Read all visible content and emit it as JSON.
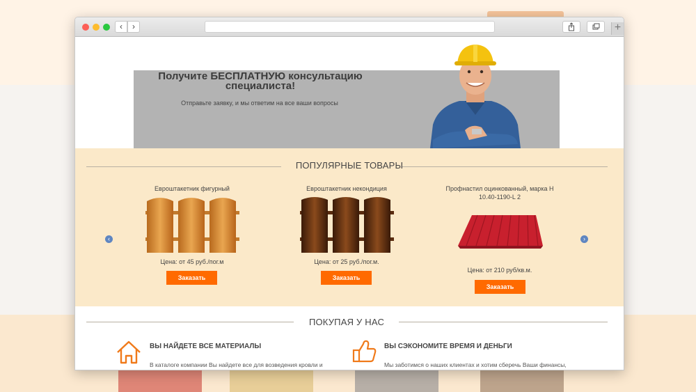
{
  "hero": {
    "title": "Получите БЕСПЛАТНУЮ консультацию специалиста!",
    "subtitle": "Отправьте заявку, и мы ответим на все ваши вопросы"
  },
  "popular": {
    "heading": "ПОПУЛЯРНЫЕ ТОВАРЫ",
    "products": [
      {
        "name": "Евроштакетник фигурный",
        "price": "Цена: от 45 руб./пог.м",
        "button": "Заказать"
      },
      {
        "name": "Евроштакетник некондиция",
        "price": "Цена: от 25 руб./пог.м.",
        "button": "Заказать"
      },
      {
        "name": "Профнастил оцинкованный, марка Н 10.40-1190-L 2",
        "price": "Цена: от 210 руб/кв.м.",
        "button": "Заказать"
      }
    ]
  },
  "buying": {
    "heading": "ПОКУПАЯ У НАС",
    "features": [
      {
        "icon": "house-icon",
        "title": "ВЫ НАЙДЕТЕ ВСЕ МАТЕРИАЛЫ",
        "text": "В каталоге компании Вы найдете все для возведения кровли и"
      },
      {
        "icon": "thumbs-up-icon",
        "title": "ВЫ СЭКОНОМИТЕ ВРЕМЯ И ДЕНЬГИ",
        "text": "Мы заботимся о наших клиентах и хотим сберечь Ваши финансы,"
      }
    ]
  },
  "colors": {
    "accent": "#ff6a00",
    "section_bg": "#fbe9c9",
    "hero_panel": "#b3b3b3",
    "arrow": "#5f86c1"
  }
}
